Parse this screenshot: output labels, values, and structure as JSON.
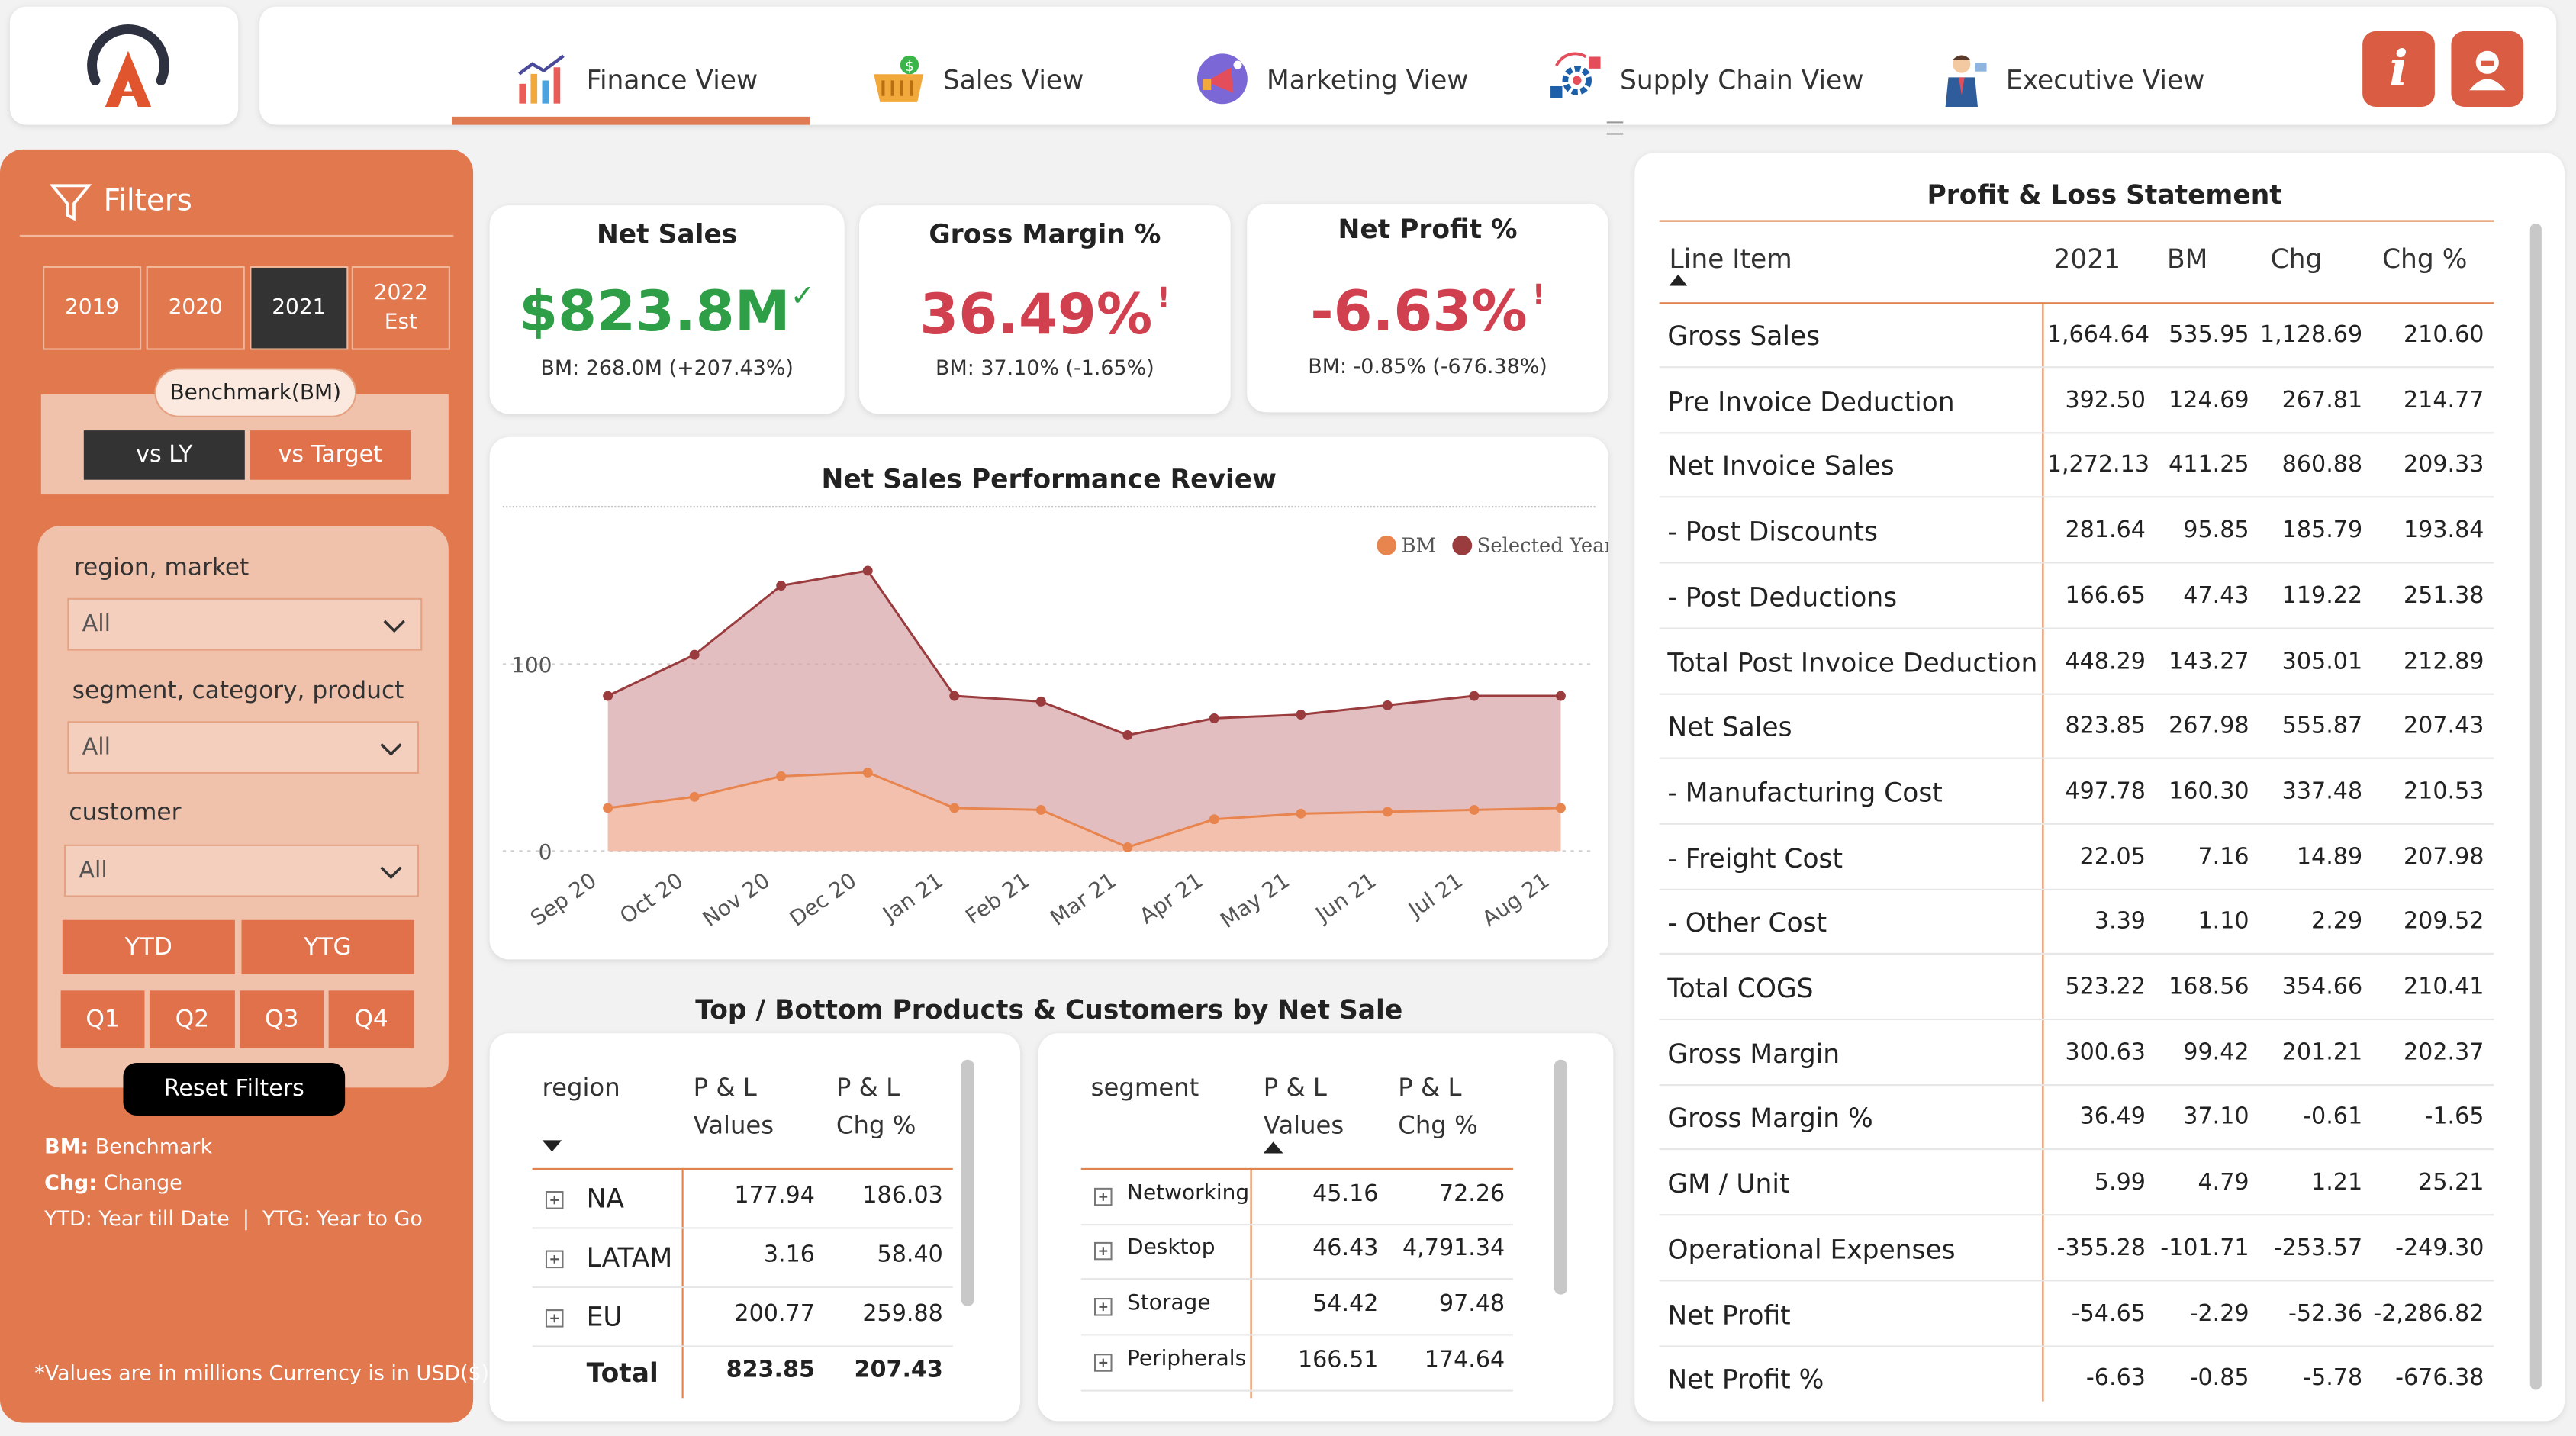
{
  "nav": {
    "tabs": [
      {
        "label": "Finance View",
        "icon": "bar-chart-icon",
        "active": true
      },
      {
        "label": "Sales View",
        "icon": "basket-icon",
        "active": false
      },
      {
        "label": "Marketing View",
        "icon": "megaphone-icon",
        "active": false
      },
      {
        "label": "Supply Chain View",
        "icon": "supply-chain-icon",
        "active": false
      },
      {
        "label": "Executive View",
        "icon": "executive-icon",
        "active": false
      }
    ],
    "info_glyph": "i",
    "accent": "#e07a52"
  },
  "filters": {
    "title": "Filters",
    "years": [
      {
        "label": "2019",
        "selected": false
      },
      {
        "label": "2020",
        "selected": false
      },
      {
        "label": "2021",
        "selected": true
      },
      {
        "label": "2022 Est",
        "selected": false
      }
    ],
    "benchmark_label": "Benchmark(BM)",
    "benchmark_options": [
      {
        "label": "vs LY",
        "selected": true
      },
      {
        "label": "vs Target",
        "selected": false
      }
    ],
    "slicers": [
      {
        "label": "region, market",
        "value": "All"
      },
      {
        "label": "segment, category, product",
        "value": "All"
      },
      {
        "label": "customer",
        "value": "All"
      }
    ],
    "period_buttons": [
      "YTD",
      "YTG"
    ],
    "quarters": [
      "Q1",
      "Q2",
      "Q3",
      "Q4"
    ],
    "reset_label": "Reset Filters",
    "legend": {
      "bm_key": "BM:",
      "bm_val": "Benchmark",
      "chg_key": "Chg:",
      "chg_val": "Change",
      "ytd_line": "YTD: Year till Date  |  YTG: Year to Go"
    },
    "footnote": "*Values are in millions Currency is in USD($)",
    "panel_color": "#e2784e"
  },
  "kpis": [
    {
      "title": "Net Sales",
      "value": "$823.8M",
      "indicator": "✓",
      "status": "good",
      "color": "#2e9e47",
      "sub": "BM: 268.0M (+207.43%)"
    },
    {
      "title": "Gross Margin %",
      "value": "36.49%",
      "indicator": "!",
      "status": "bad",
      "color": "#d1404e",
      "sub": "BM: 37.10% (-1.65%)"
    },
    {
      "title": "Net Profit %",
      "value": "-6.63%",
      "indicator": "!",
      "status": "bad",
      "color": "#d1404e",
      "sub": "BM: -0.85% (-676.38%)"
    }
  ],
  "chart_data": {
    "type": "area",
    "title": "Net Sales Performance Review",
    "categories": [
      "Sep 20",
      "Oct 20",
      "Nov 20",
      "Dec 20",
      "Jan 21",
      "Feb 21",
      "Mar 21",
      "Apr 21",
      "May 21",
      "Jun 21",
      "Jul 21",
      "Aug 21"
    ],
    "series": [
      {
        "name": "BM",
        "color": "#e8854f",
        "values": [
          23,
          29,
          40,
          42,
          23,
          22,
          2,
          17,
          20,
          21,
          22,
          23
        ]
      },
      {
        "name": "Selected Year",
        "color": "#9a3b3e",
        "values": [
          83,
          105,
          142,
          150,
          83,
          80,
          62,
          71,
          73,
          78,
          83,
          83
        ]
      }
    ],
    "yticks": [
      0,
      100
    ],
    "ylim": [
      0,
      160
    ],
    "grid": true,
    "legend_position": "top-right"
  },
  "products_title": "Top / Bottom Products & Customers by Net Sale",
  "region_table": {
    "headers": {
      "dim": "region",
      "values": "P & L Values",
      "chg": "P & L Chg %"
    },
    "rows": [
      {
        "label": "NA",
        "values": "177.94",
        "chg": "186.03"
      },
      {
        "label": "LATAM",
        "values": "3.16",
        "chg": "58.40"
      },
      {
        "label": "EU",
        "values": "200.77",
        "chg": "259.88"
      }
    ],
    "total": {
      "label": "Total",
      "values": "823.85",
      "chg": "207.43"
    }
  },
  "segment_table": {
    "headers": {
      "dim": "segment",
      "values": "P & L Values",
      "chg": "P & L Chg %"
    },
    "rows": [
      {
        "label": "Networking",
        "values": "45.16",
        "chg": "72.26"
      },
      {
        "label": "Desktop",
        "values": "46.43",
        "chg": "4,791.34"
      },
      {
        "label": "Storage",
        "values": "54.42",
        "chg": "97.48"
      },
      {
        "label": "Peripherals",
        "values": "166.51",
        "chg": "174.64"
      }
    ]
  },
  "pl": {
    "title": "Profit & Loss Statement",
    "headers": [
      "Line Item",
      "2021",
      "BM",
      "Chg",
      "Chg %"
    ],
    "rows": [
      {
        "label": "Gross Sales",
        "v": "1,664.64",
        "bm": "535.95",
        "chg": "1,128.69",
        "pct": "210.60"
      },
      {
        "label": "Pre Invoice Deduction",
        "v": "392.50",
        "bm": "124.69",
        "chg": "267.81",
        "pct": "214.77"
      },
      {
        "label": "Net Invoice Sales",
        "v": "1,272.13",
        "bm": "411.25",
        "chg": "860.88",
        "pct": "209.33"
      },
      {
        "label": "- Post Discounts",
        "v": "281.64",
        "bm": "95.85",
        "chg": "185.79",
        "pct": "193.84"
      },
      {
        "label": "- Post Deductions",
        "v": "166.65",
        "bm": "47.43",
        "chg": "119.22",
        "pct": "251.38"
      },
      {
        "label": "Total Post Invoice Deduction",
        "v": "448.29",
        "bm": "143.27",
        "chg": "305.01",
        "pct": "212.89"
      },
      {
        "label": "Net Sales",
        "v": "823.85",
        "bm": "267.98",
        "chg": "555.87",
        "pct": "207.43"
      },
      {
        "label": "- Manufacturing Cost",
        "v": "497.78",
        "bm": "160.30",
        "chg": "337.48",
        "pct": "210.53"
      },
      {
        "label": "- Freight Cost",
        "v": "22.05",
        "bm": "7.16",
        "chg": "14.89",
        "pct": "207.98"
      },
      {
        "label": "- Other Cost",
        "v": "3.39",
        "bm": "1.10",
        "chg": "2.29",
        "pct": "209.52"
      },
      {
        "label": "Total COGS",
        "v": "523.22",
        "bm": "168.56",
        "chg": "354.66",
        "pct": "210.41"
      },
      {
        "label": "Gross Margin",
        "v": "300.63",
        "bm": "99.42",
        "chg": "201.21",
        "pct": "202.37"
      },
      {
        "label": "Gross Margin %",
        "v": "36.49",
        "bm": "37.10",
        "chg": "-0.61",
        "pct": "-1.65"
      },
      {
        "label": "GM / Unit",
        "v": "5.99",
        "bm": "4.79",
        "chg": "1.21",
        "pct": "25.21"
      },
      {
        "label": "Operational Expenses",
        "v": "-355.28",
        "bm": "-101.71",
        "chg": "-253.57",
        "pct": "-249.30"
      },
      {
        "label": "Net Profit",
        "v": "-54.65",
        "bm": "-2.29",
        "chg": "-52.36",
        "pct": "-2,286.82"
      },
      {
        "label": "Net Profit %",
        "v": "-6.63",
        "bm": "-0.85",
        "chg": "-5.78",
        "pct": "-676.38"
      }
    ]
  }
}
